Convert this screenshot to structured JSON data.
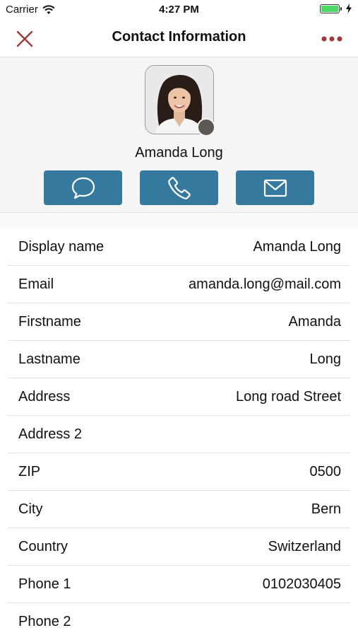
{
  "status_bar": {
    "carrier": "Carrier",
    "time": "4:27 PM"
  },
  "nav": {
    "title": "Contact Information"
  },
  "contact": {
    "name": "Amanda Long"
  },
  "colors": {
    "accent": "#35799f",
    "close_icon": "#9e3a3a",
    "presence": "#5e5852"
  },
  "icons": [
    "close-icon",
    "more-dots-icon",
    "chat-bubble-icon",
    "phone-icon",
    "mail-icon"
  ],
  "details": [
    {
      "label": "Display name",
      "value": "Amanda Long"
    },
    {
      "label": "Email",
      "value": "amanda.long@mail.com"
    },
    {
      "label": "Firstname",
      "value": "Amanda"
    },
    {
      "label": "Lastname",
      "value": "Long"
    },
    {
      "label": "Address",
      "value": "Long road Street"
    },
    {
      "label": "Address 2",
      "value": ""
    },
    {
      "label": "ZIP",
      "value": "0500"
    },
    {
      "label": "City",
      "value": "Bern"
    },
    {
      "label": "Country",
      "value": "Switzerland"
    },
    {
      "label": "Phone 1",
      "value": "0102030405"
    },
    {
      "label": "Phone 2",
      "value": ""
    }
  ]
}
